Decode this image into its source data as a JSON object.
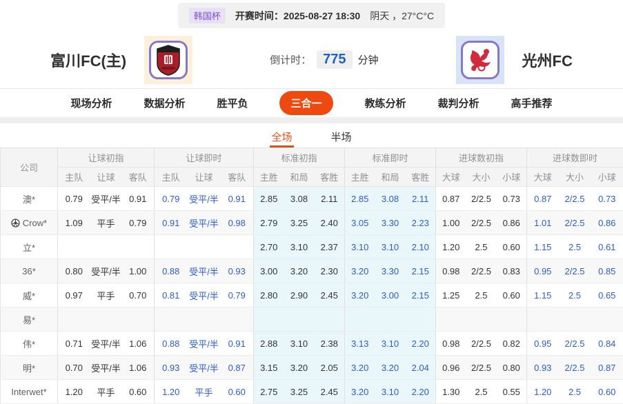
{
  "topbar": {
    "league_badge": "韩国杯",
    "kickoff_label": "开赛时间：",
    "kickoff_datetime": "2025-08-27 18:30",
    "weather": "阴天 ，27°C°C"
  },
  "match": {
    "home_team": "富川FC(主)",
    "away_team": "光州FC",
    "home_logo_icon": "bucheon-fc-crest-icon",
    "away_logo_icon": "gwangju-fc-crest-icon",
    "countdown_label": "倒计时：",
    "countdown_minutes": "775",
    "countdown_unit": "分钟"
  },
  "nav": {
    "items": [
      {
        "label": "现场分析",
        "active": false
      },
      {
        "label": "数据分析",
        "active": false
      },
      {
        "label": "胜平负",
        "active": false
      },
      {
        "label": "三合一",
        "active": true
      },
      {
        "label": "教练分析",
        "active": false
      },
      {
        "label": "裁判分析",
        "active": false
      },
      {
        "label": "高手推荐",
        "active": false
      }
    ]
  },
  "subtabs": {
    "items": [
      {
        "label": "全场",
        "active": true
      },
      {
        "label": "半场",
        "active": false
      }
    ]
  },
  "table": {
    "company_header": "公司",
    "groups": [
      {
        "label": "让球初指",
        "cols": [
          "主队",
          "让球",
          "客队"
        ]
      },
      {
        "label": "让球即时",
        "cols": [
          "主队",
          "让球",
          "客队"
        ]
      },
      {
        "label": "标准初指",
        "cols": [
          "主胜",
          "和局",
          "客胜"
        ]
      },
      {
        "label": "标准即时",
        "cols": [
          "主胜",
          "和局",
          "客胜"
        ]
      },
      {
        "label": "进球数初指",
        "cols": [
          "大球",
          "大小",
          "小球"
        ]
      },
      {
        "label": "进球数即时",
        "cols": [
          "大球",
          "大小",
          "小球"
        ]
      }
    ],
    "rows": [
      {
        "company": "澳*",
        "icon": null,
        "cells": [
          "0.79",
          "受平/半",
          "0.91",
          "0.79",
          "受平/半",
          "0.91",
          "2.85",
          "3.08",
          "2.11",
          "2.85",
          "3.08",
          "2.11",
          "0.87",
          "2/2.5",
          "0.73",
          "0.87",
          "2/2.5",
          "0.73"
        ]
      },
      {
        "company": "Crow*",
        "icon": "soccer-ball-icon",
        "cells": [
          "1.09",
          "平手",
          "0.79",
          "0.91",
          "受平/半",
          "0.98",
          "2.79",
          "3.25",
          "2.40",
          "3.05",
          "3.30",
          "2.23",
          "1.00",
          "2/2.5",
          "0.86",
          "1.01",
          "2/2.5",
          "0.86"
        ]
      },
      {
        "company": "立*",
        "icon": null,
        "cells": [
          "",
          "",
          "",
          "",
          "",
          "",
          "2.70",
          "3.10",
          "2.37",
          "3.10",
          "3.10",
          "2.10",
          "1.20",
          "2.5",
          "0.60",
          "1.15",
          "2.5",
          "0.61"
        ]
      },
      {
        "company": "36*",
        "icon": null,
        "cells": [
          "0.80",
          "受平/半",
          "1.00",
          "0.88",
          "受平/半",
          "0.93",
          "3.00",
          "3.20",
          "2.30",
          "3.20",
          "3.30",
          "2.15",
          "0.98",
          "2/2.5",
          "0.83",
          "0.95",
          "2/2.5",
          "0.85"
        ]
      },
      {
        "company": "威*",
        "icon": null,
        "cells": [
          "0.97",
          "平手",
          "0.70",
          "0.81",
          "受平/半",
          "0.79",
          "2.80",
          "2.90",
          "2.45",
          "3.20",
          "3.00",
          "2.15",
          "1.25",
          "2.5",
          "0.60",
          "1.15",
          "2.5",
          "0.65"
        ]
      },
      {
        "company": "易*",
        "icon": null,
        "cells": [
          "",
          "",
          "",
          "",
          "",
          "",
          "",
          "",
          "",
          "",
          "",
          "",
          "",
          "",
          "",
          "",
          "",
          ""
        ]
      },
      {
        "company": "伟*",
        "icon": null,
        "cells": [
          "0.71",
          "受平/半",
          "1.06",
          "0.88",
          "受平/半",
          "0.91",
          "2.88",
          "3.10",
          "2.38",
          "3.13",
          "3.10",
          "2.20",
          "0.98",
          "2/2.5",
          "0.82",
          "0.95",
          "2/2.5",
          "0.84"
        ]
      },
      {
        "company": "明*",
        "icon": null,
        "cells": [
          "0.70",
          "受平/半",
          "1.06",
          "0.93",
          "受平/半",
          "0.87",
          "3.15",
          "3.20",
          "2.05",
          "3.20",
          "3.20",
          "2.04",
          "0.96",
          "2/2.5",
          "0.80",
          "0.93",
          "2/2.5",
          "0.87"
        ]
      },
      {
        "company": "Interwet*",
        "icon": null,
        "cells": [
          "1.20",
          "平手",
          "0.60",
          "1.20",
          "平手",
          "0.60",
          "2.75",
          "3.25",
          "2.45",
          "3.20",
          "3.10",
          "2.20",
          "1.30",
          "2.5",
          "0.55",
          "1.20",
          "2.5",
          "0.60"
        ]
      }
    ]
  },
  "colors": {
    "accent_orange": "#ee4a0f",
    "live_blue": "#2a5dc9",
    "standard_col_cyan": "#eaf7fa",
    "badge_purple": "#7a4fd0",
    "countdown_blue": "#1b62c4",
    "logo_border_purple": "#8578cb"
  }
}
